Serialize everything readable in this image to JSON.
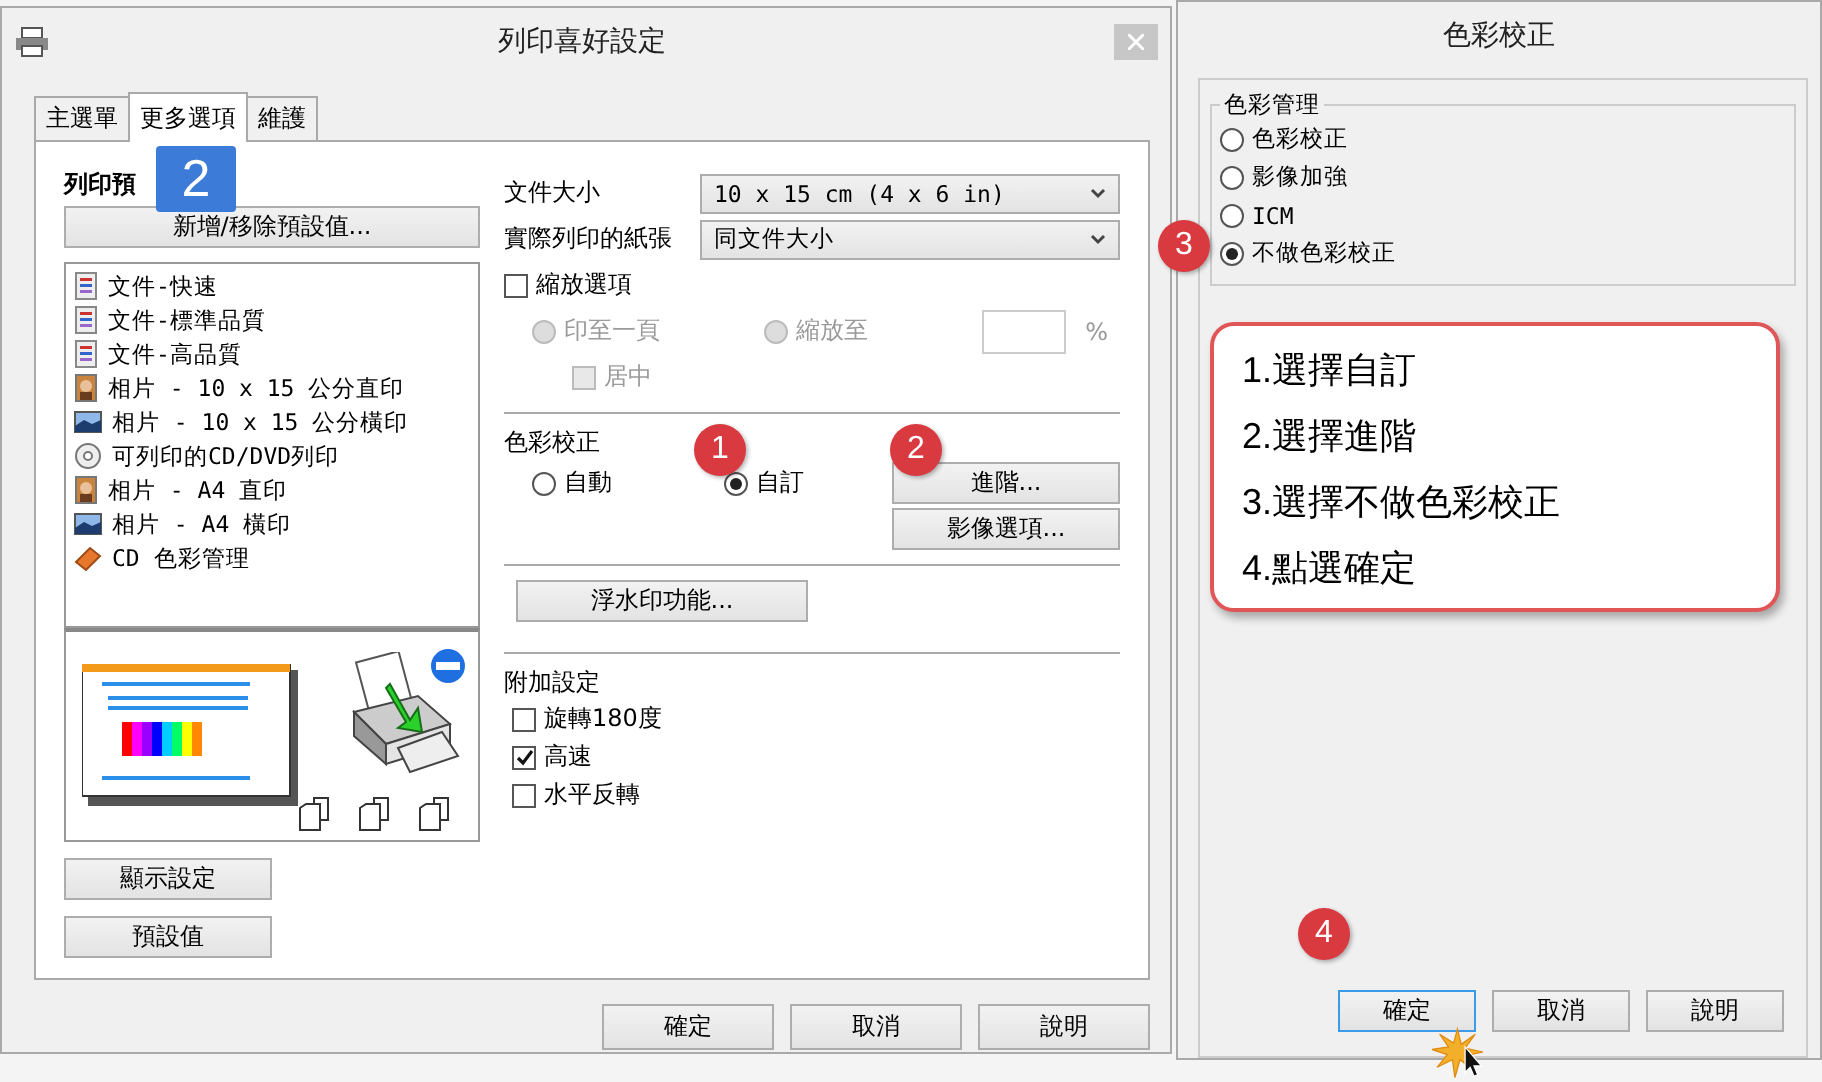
{
  "print_window": {
    "title": "列印喜好設定",
    "tabs": [
      {
        "label": "主選單",
        "selected": false
      },
      {
        "label": "更多選項",
        "selected": true
      },
      {
        "label": "維護",
        "selected": false
      }
    ],
    "presets": {
      "heading": "列印預",
      "add_remove_button": "新增/移除預設值...",
      "items": [
        {
          "kind": "document",
          "label": "文件-快速"
        },
        {
          "kind": "document",
          "label": "文件-標準品質"
        },
        {
          "kind": "document",
          "label": "文件-高品質"
        },
        {
          "kind": "photo_portrait",
          "label": "相片 - 10 x 15 公分直印"
        },
        {
          "kind": "photo_landscape",
          "label": "相片 - 10 x 15 公分橫印"
        },
        {
          "kind": "disc",
          "label": "可列印的CD/DVD列印"
        },
        {
          "kind": "photo_portrait",
          "label": "相片 - A4 直印"
        },
        {
          "kind": "photo_landscape",
          "label": "相片 - A4 橫印"
        },
        {
          "kind": "cd_label",
          "label": "CD 色彩管理"
        }
      ]
    },
    "left_buttons": [
      "顯示設定",
      "預設值"
    ],
    "document_size": {
      "label": "文件大小",
      "value": "10 x 15 cm (4 x 6 in)"
    },
    "output_paper": {
      "label": "實際列印的紙張",
      "value": "同文件大小"
    },
    "scale_options": {
      "label": "縮放選項",
      "checked": false,
      "fit_page": {
        "label": "印至一頁",
        "selected": false,
        "disabled": true
      },
      "scale_to": {
        "label": "縮放至",
        "selected": false,
        "disabled": true
      },
      "percent": "%",
      "center": {
        "label": "居中",
        "checked": false,
        "disabled": true
      }
    },
    "color_correction": {
      "heading": "色彩校正",
      "options": [
        {
          "label": "自動",
          "selected": false
        },
        {
          "label": "自訂",
          "selected": true
        }
      ],
      "advanced_button": "進階...",
      "image_options_button": "影像選項..."
    },
    "watermark_button": "浮水印功能...",
    "extra_settings": {
      "heading": "附加設定",
      "options": [
        {
          "label": "旋轉180度",
          "checked": false
        },
        {
          "label": "高速",
          "checked": true
        },
        {
          "label": "水平反轉",
          "checked": false
        }
      ]
    },
    "footer_buttons": [
      "確定",
      "取消",
      "說明"
    ]
  },
  "color_window": {
    "title": "色彩校正",
    "group": "色彩管理",
    "options": [
      {
        "label": "色彩校正",
        "selected": false
      },
      {
        "label": "影像加強",
        "selected": false
      },
      {
        "label": "ICM",
        "selected": false
      },
      {
        "label": "不做色彩校正",
        "selected": true
      }
    ],
    "instructions": [
      "1.選擇自訂",
      "2.選擇進階",
      "3.選擇不做色彩校正",
      "4.點選確定"
    ],
    "buttons": [
      {
        "label": "確定",
        "focused": true
      },
      {
        "label": "取消",
        "focused": false
      },
      {
        "label": "說明",
        "focused": false
      }
    ]
  },
  "annotations": [
    {
      "kind": "square",
      "text": "2"
    },
    {
      "kind": "circle",
      "text": "1"
    },
    {
      "kind": "circle",
      "text": "2"
    },
    {
      "kind": "circle",
      "text": "3"
    },
    {
      "kind": "circle",
      "text": "4"
    }
  ]
}
